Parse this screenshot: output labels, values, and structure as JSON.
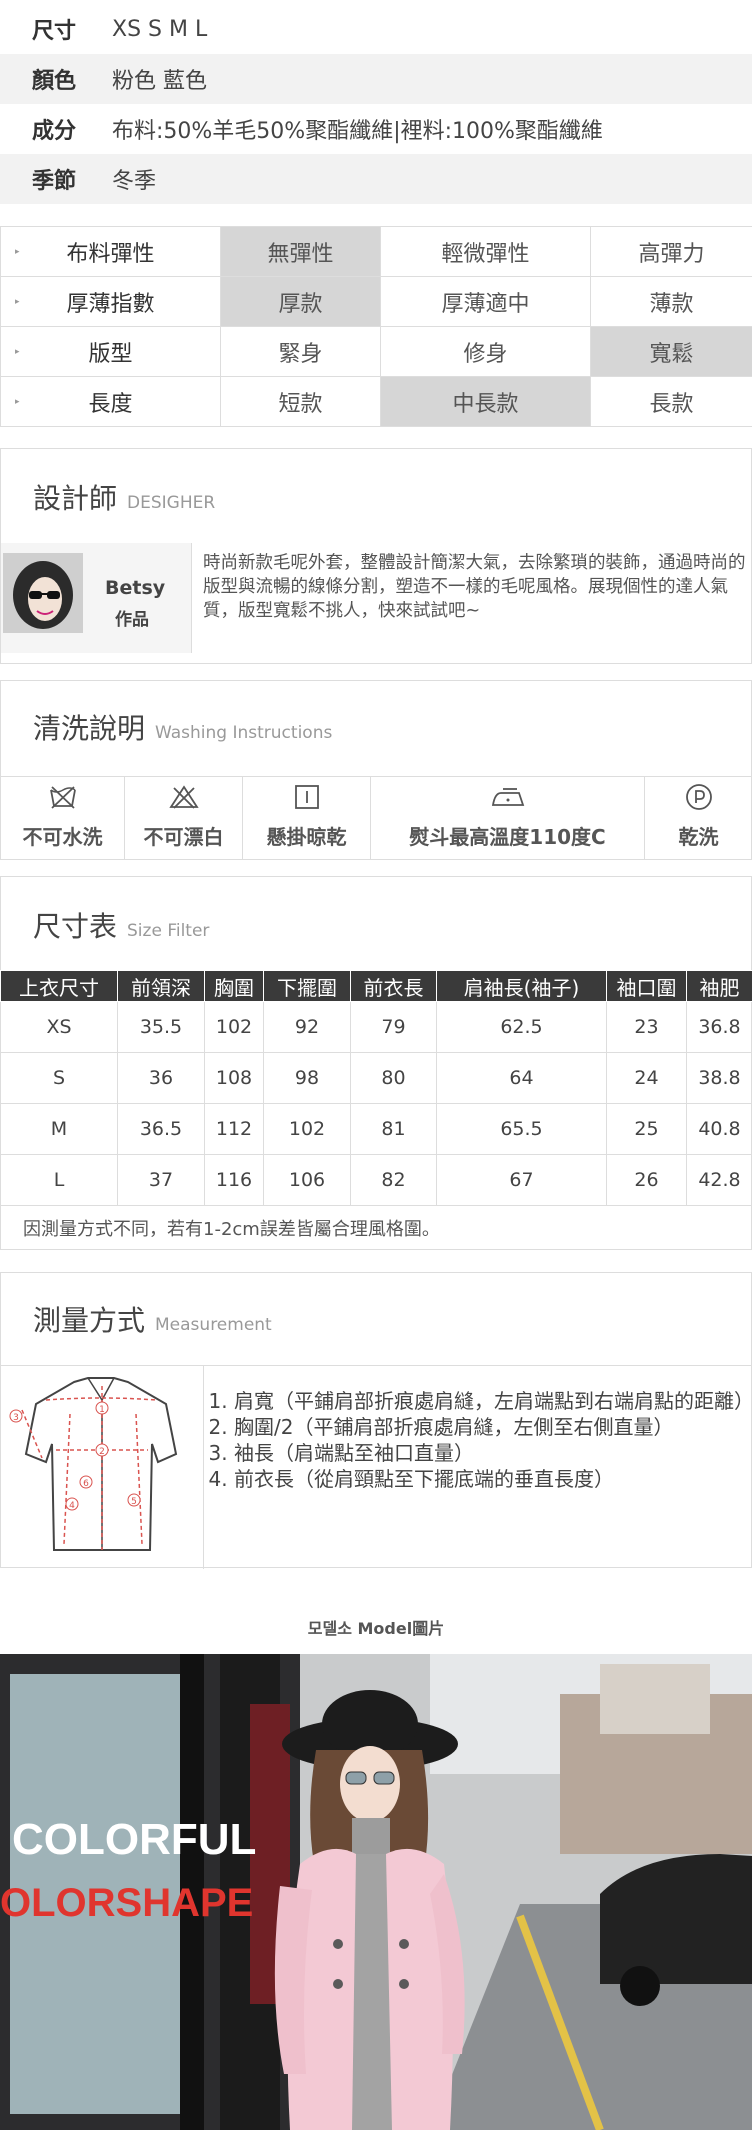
{
  "attributes": [
    {
      "key": "尺寸",
      "value": "XS S M L"
    },
    {
      "key": "顏色",
      "value": "粉色 藍色"
    },
    {
      "key": "成分",
      "value": "布料:50%羊毛50%聚酯纖維|裡料:100%聚酯纖維"
    },
    {
      "key": "季節",
      "value": "冬季"
    }
  ],
  "features": [
    {
      "label": "布料彈性",
      "options": [
        "無彈性",
        "輕微彈性",
        "高彈力"
      ],
      "selected": 0
    },
    {
      "label": "厚薄指數",
      "options": [
        "厚款",
        "厚薄適中",
        "薄款"
      ],
      "selected": 0
    },
    {
      "label": "版型",
      "options": [
        "緊身",
        "修身",
        "寬鬆"
      ],
      "selected": 2
    },
    {
      "label": "長度",
      "options": [
        "短款",
        "中長款",
        "長款"
      ],
      "selected": 1
    }
  ],
  "designer": {
    "title": "設計師",
    "subtitle": "DESIGHER",
    "name": "Betsy",
    "tag": "作品",
    "text": "時尚新款毛呢外套，整體設計簡潔大氣，去除繁瑣的裝飾，通過時尚的版型與流暢的線條分割，塑造不一樣的毛呢風格。展現個性的達人氣質，版型寬鬆不挑人，快來試試吧~"
  },
  "washing": {
    "title": "清洗說明",
    "subtitle": "Washing Instructions",
    "items": [
      {
        "icon": "no-wash-icon",
        "label": "不可水洗"
      },
      {
        "icon": "no-bleach-icon",
        "label": "不可漂白"
      },
      {
        "icon": "hang-dry-icon",
        "label": "懸掛晾乾"
      },
      {
        "icon": "iron-icon",
        "label": "熨斗最高溫度110度C"
      },
      {
        "icon": "dry-clean-icon",
        "label": "乾洗"
      }
    ]
  },
  "size_table": {
    "title": "尺寸表",
    "subtitle": "Size Filter",
    "headers": [
      "上衣尺寸",
      "前領深",
      "胸圍",
      "下擺圍",
      "前衣長",
      "肩袖長(袖子)",
      "袖口圍",
      "袖肥"
    ],
    "rows": [
      [
        "XS",
        "35.5",
        "102",
        "92",
        "79",
        "62.5",
        "23",
        "36.8"
      ],
      [
        "S",
        "36",
        "108",
        "98",
        "80",
        "64",
        "24",
        "38.8"
      ],
      [
        "M",
        "36.5",
        "112",
        "102",
        "81",
        "65.5",
        "25",
        "40.8"
      ],
      [
        "L",
        "37",
        "116",
        "106",
        "82",
        "67",
        "26",
        "42.8"
      ]
    ],
    "note": "因測量方式不同，若有1-2cm誤差皆屬合理風格圍。"
  },
  "measurement": {
    "title": "測量方式",
    "subtitle": "Measurement",
    "items": [
      "肩寬（平鋪肩部折痕處肩縫，左肩端點到右端肩點的距離）",
      "胸圍/2（平鋪肩部折痕處肩縫，左側至右側直量）",
      "袖長（肩端點至袖口直量）",
      "前衣長（從肩頸點至下擺底端的垂直長度）"
    ],
    "diagram_markers": [
      "1",
      "2",
      "3",
      "4",
      "5",
      "6"
    ]
  },
  "model": {
    "title": "모델소 Model圖片",
    "sign_line1": "COLORFUL",
    "sign_line2": "OLORSHAPE"
  },
  "colors": {
    "header_dark": "#3a3a3a",
    "selected_cell": "#d6d6d6",
    "coat_pink": "#f3c9d4",
    "diagram_red": "#d9534f"
  }
}
